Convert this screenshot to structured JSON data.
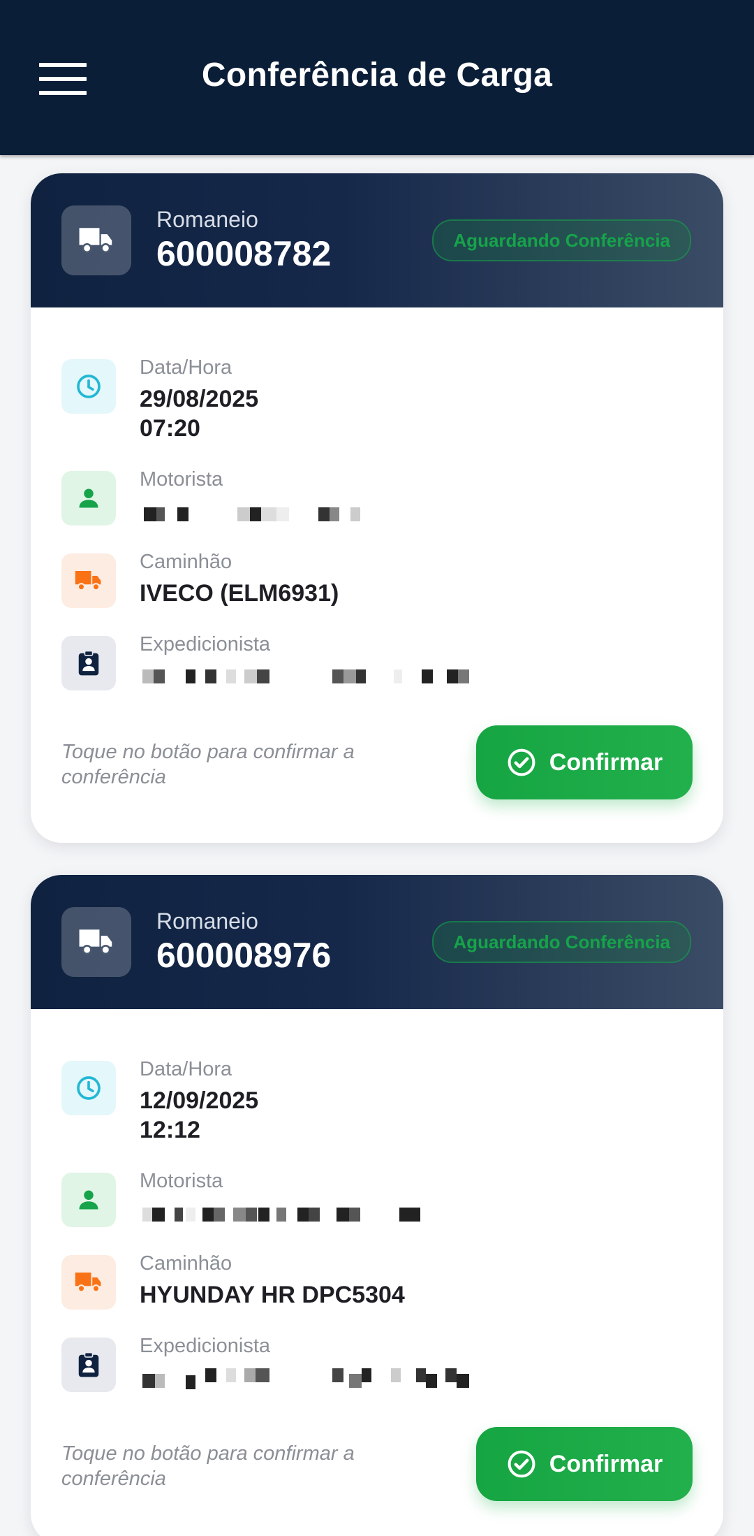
{
  "app_bar": {
    "title": "Conferência de Carga",
    "menu_icon": "hamburger-menu-icon"
  },
  "colors": {
    "app_bar_bg": "#0b1e38",
    "status_green": "#16a34a",
    "button_green": "#22b04c",
    "clock_cyan": "#22b8d4",
    "person_green": "#16a34a",
    "truck_orange": "#f97316",
    "badge_navy": "#0f2240"
  },
  "cards": [
    {
      "header_label": "Romaneio",
      "number": "600008782",
      "status": "Aguardando Conferência",
      "fields": {
        "datetime_label": "Data/Hora",
        "date": "29/08/2025",
        "time": "07:20",
        "driver_label": "Motorista",
        "truck_label": "Caminhão",
        "truck_value": "IVECO (ELM6931)",
        "expeditor_label": "Expedicionista"
      },
      "hint": "Toque no botão para confirmar a conferência",
      "confirm_label": "Confirmar"
    },
    {
      "header_label": "Romaneio",
      "number": "600008976",
      "status": "Aguardando Conferência",
      "fields": {
        "datetime_label": "Data/Hora",
        "date": "12/09/2025",
        "time": "12:12",
        "driver_label": "Motorista",
        "truck_label": "Caminhão",
        "truck_value": "HYUNDAY HR DPC5304",
        "expeditor_label": "Expedicionista"
      },
      "hint": "Toque no botão para confirmar a conferência",
      "confirm_label": "Confirmar"
    }
  ]
}
